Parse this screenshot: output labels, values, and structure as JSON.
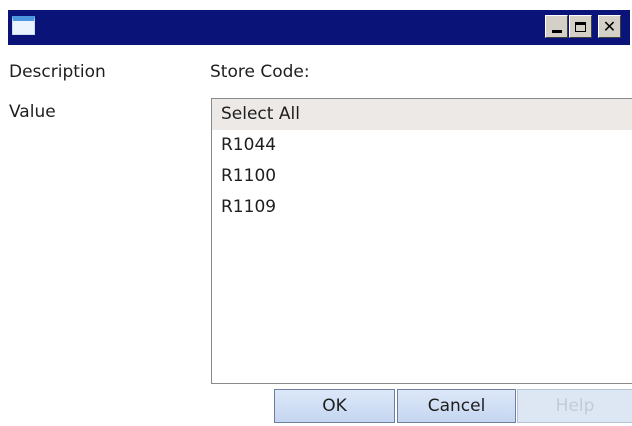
{
  "window": {
    "icon": "app-window-icon",
    "controls": {
      "minimize_icon": "minimize-icon",
      "maximize_icon": "maximize-icon",
      "close_icon": "close-icon",
      "close_glyph": "✕"
    },
    "titlebar_color": "#0a1478"
  },
  "form": {
    "description_label": "Description",
    "store_code_label": "Store Code:",
    "value_label": "Value"
  },
  "listbox": {
    "items": [
      {
        "label": "Select All",
        "selected": true
      },
      {
        "label": "R1044",
        "selected": false
      },
      {
        "label": "R1100",
        "selected": false
      },
      {
        "label": "R1109",
        "selected": false
      }
    ]
  },
  "buttons": {
    "ok": "OK",
    "cancel": "Cancel",
    "help": "Help",
    "help_disabled": true
  }
}
